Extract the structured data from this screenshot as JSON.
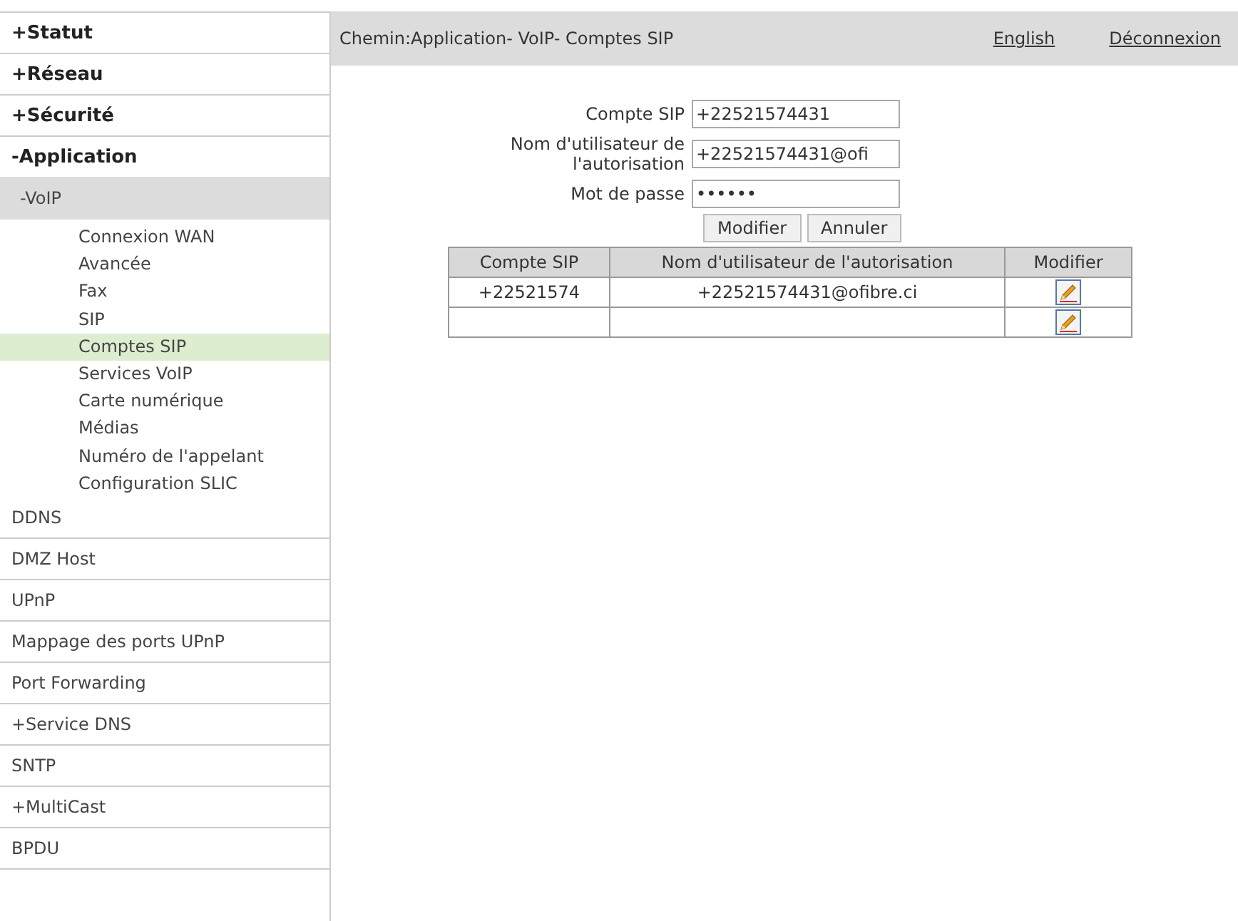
{
  "sidebar": {
    "items": [
      {
        "kind": "section",
        "label": "+Statut",
        "selected": false
      },
      {
        "kind": "section",
        "label": "+Réseau",
        "selected": false
      },
      {
        "kind": "section",
        "label": "+Sécurité",
        "selected": false
      },
      {
        "kind": "section",
        "label": "-Application",
        "selected": false
      },
      {
        "kind": "group",
        "label": "-VoIP",
        "selected": false
      },
      {
        "kind": "leaf",
        "label": "Connexion WAN",
        "selected": false
      },
      {
        "kind": "leaf",
        "label": "Avancée",
        "selected": false
      },
      {
        "kind": "leaf",
        "label": "Fax",
        "selected": false
      },
      {
        "kind": "leaf",
        "label": "SIP",
        "selected": false
      },
      {
        "kind": "leaf",
        "label": "Comptes SIP",
        "selected": true
      },
      {
        "kind": "leaf",
        "label": "Services VoIP",
        "selected": false
      },
      {
        "kind": "leaf",
        "label": "Carte numérique",
        "selected": false
      },
      {
        "kind": "leaf",
        "label": "Médias",
        "selected": false
      },
      {
        "kind": "leaf",
        "label": "Numéro de l'appelant",
        "selected": false
      },
      {
        "kind": "leaf",
        "label": "Configuration SLIC",
        "selected": false
      },
      {
        "kind": "item",
        "label": "DDNS",
        "selected": false
      },
      {
        "kind": "item",
        "label": "DMZ Host",
        "selected": false
      },
      {
        "kind": "item",
        "label": "UPnP",
        "selected": false
      },
      {
        "kind": "item",
        "label": "Mappage des ports UPnP",
        "selected": false
      },
      {
        "kind": "item",
        "label": "Port Forwarding",
        "selected": false
      },
      {
        "kind": "item",
        "label": "+Service DNS",
        "selected": false
      },
      {
        "kind": "item",
        "label": "SNTP",
        "selected": false
      },
      {
        "kind": "item",
        "label": "+MultiCast",
        "selected": false
      },
      {
        "kind": "item",
        "label": "BPDU",
        "selected": false
      }
    ]
  },
  "header": {
    "path": "Chemin:Application- VoIP- Comptes SIP",
    "links": [
      "English",
      "Déconnexion"
    ]
  },
  "form": {
    "fields": [
      {
        "label": "Compte SIP",
        "value": "+22521574431"
      },
      {
        "label": "Nom d'utilisateur de l'autorisation",
        "value": "+22521574431@ofi"
      },
      {
        "label": "Mot de passe",
        "value": "••••••"
      }
    ],
    "buttons": [
      "Modifier",
      "Annuler"
    ]
  },
  "table": {
    "columns": [
      "Compte SIP",
      "Nom d'utilisateur de l'autorisation",
      "Modifier"
    ],
    "rows": [
      {
        "account": "+22521574",
        "user": "+22521574431@ofibre.ci"
      },
      {
        "account": "",
        "user": ""
      }
    ]
  }
}
